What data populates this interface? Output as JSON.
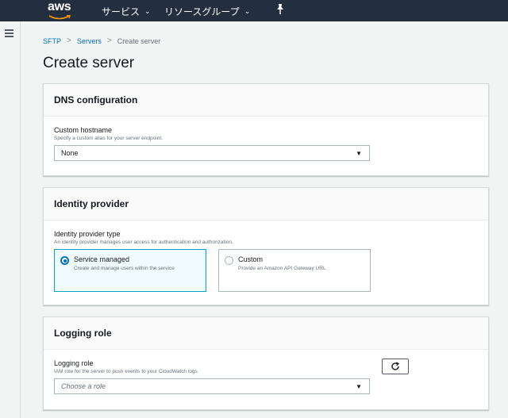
{
  "topnav": {
    "logo_text": "aws",
    "services_label": "サービス",
    "resource_groups_label": "リソースグループ"
  },
  "breadcrumb": {
    "items": [
      "SFTP",
      "Servers"
    ],
    "current": "Create server"
  },
  "page": {
    "title": "Create server"
  },
  "dns": {
    "header": "DNS configuration",
    "hostname_label": "Custom hostname",
    "hostname_desc": "Specify a custom alias for your server endpoint.",
    "hostname_value": "None"
  },
  "identity": {
    "header": "Identity provider",
    "type_label": "Identity provider type",
    "type_desc": "An identity provider manages user access for authentication and authorization.",
    "options": [
      {
        "title": "Service managed",
        "desc": "Create and manage users within the service",
        "selected": true
      },
      {
        "title": "Custom",
        "desc": "Provide an Amazon API Gateway URL",
        "selected": false
      }
    ]
  },
  "logging": {
    "header": "Logging role",
    "role_label": "Logging role",
    "role_desc": "IAM role for the server to push events to your CloudWatch logs",
    "role_placeholder": "Choose a role"
  },
  "colors": {
    "nav_bg": "#232f3e",
    "link": "#0073bb",
    "selected_border": "#00a1c9",
    "logo_smile": "#ff9900"
  }
}
